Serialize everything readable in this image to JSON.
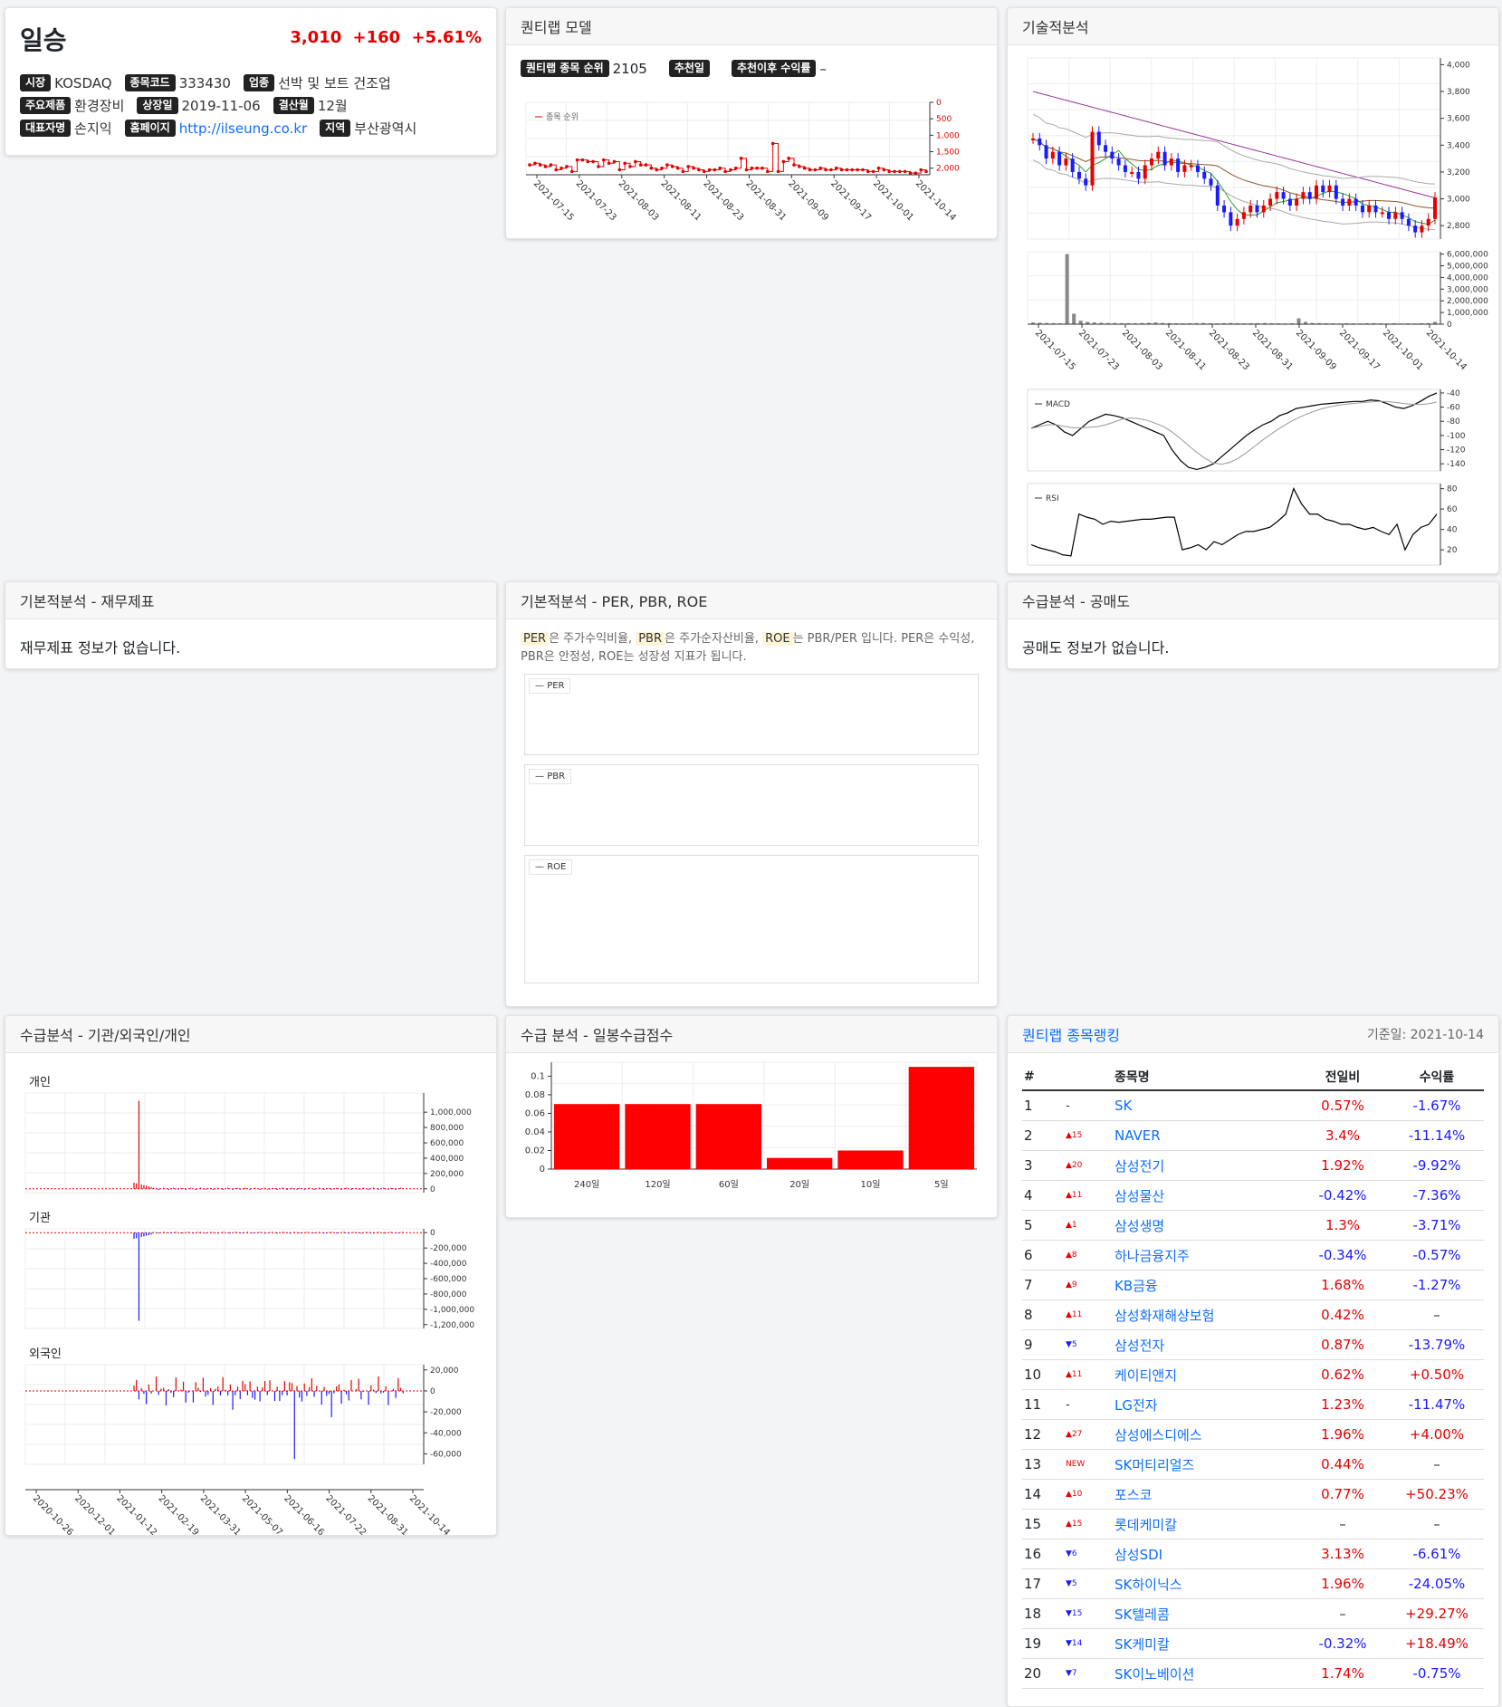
{
  "stock": {
    "name": "일승",
    "price": "3,010",
    "change": "+160",
    "change_pct": "+5.61%",
    "info": [
      [
        {
          "label": "시장",
          "value": "KOSDAQ"
        },
        {
          "label": "종목코드",
          "value": "333430"
        },
        {
          "label": "업종",
          "value": "선박 및 보트 건조업"
        }
      ],
      [
        {
          "label": "주요제품",
          "value": "환경장비"
        },
        {
          "label": "상장일",
          "value": "2019-11-06"
        },
        {
          "label": "결산월",
          "value": "12월"
        }
      ],
      [
        {
          "label": "대표자명",
          "value": "손지익"
        },
        {
          "label": "홈페이지",
          "value": "http://ilseung.co.kr",
          "link": true
        },
        {
          "label": "지역",
          "value": "부산광역시"
        }
      ]
    ]
  },
  "quantilab": {
    "title": "퀀티랩 모델",
    "rank_label": "퀀티랩 종목 순위",
    "rank_value": "2105",
    "recommend_label": "추천일",
    "recommend_value": "",
    "return_label": "추천이후 수익률",
    "return_value": "–"
  },
  "technical": {
    "title": "기술적분석"
  },
  "fundamental": {
    "title": "기본적분석 - 재무제표",
    "empty": "재무제표 정보가 없습니다."
  },
  "ratios": {
    "title": "기본적분석 - PER, PBR, ROE",
    "desc": [
      {
        "t": "PER",
        "hl": true
      },
      {
        "t": "은 주가수익비율, "
      },
      {
        "t": "PBR",
        "hl": true
      },
      {
        "t": "은 주가순자산비율, "
      },
      {
        "t": "ROE",
        "hl": true
      },
      {
        "t": "는 PBR/PER 입니다. PER은 수익성, PBR은 안정성, ROE는 성장성 지표가 됩니다."
      }
    ],
    "legends": [
      "PER",
      "PBR",
      "ROE"
    ]
  },
  "short": {
    "title": "수급분석 - 공매도",
    "empty": "공매도 정보가 없습니다."
  },
  "investor": {
    "title": "수급분석 - 기관/외국인/개인",
    "labels": [
      "개인",
      "기관",
      "외국인"
    ]
  },
  "daily": {
    "title": "수급 분석 - 일봉수급점수"
  },
  "ranking": {
    "title": "퀀티랩 종목랭킹",
    "date": "기준일: 2021-10-14",
    "headers": [
      "#",
      "",
      "종목명",
      "전일비",
      "수익률"
    ],
    "rows": [
      {
        "n": "1",
        "mv": "-",
        "dir": "none",
        "name": "SK",
        "chg": "0.57%",
        "ret": "-1.67%"
      },
      {
        "n": "2",
        "mv": "▲15",
        "dir": "up",
        "name": "NAVER",
        "chg": "3.4%",
        "ret": "-11.14%"
      },
      {
        "n": "3",
        "mv": "▲20",
        "dir": "up",
        "name": "삼성전기",
        "chg": "1.92%",
        "ret": "-9.92%"
      },
      {
        "n": "4",
        "mv": "▲11",
        "dir": "up",
        "name": "삼성물산",
        "chg": "-0.42%",
        "ret": "-7.36%"
      },
      {
        "n": "5",
        "mv": "▲1",
        "dir": "up",
        "name": "삼성생명",
        "chg": "1.3%",
        "ret": "-3.71%"
      },
      {
        "n": "6",
        "mv": "▲8",
        "dir": "up",
        "name": "하나금융지주",
        "chg": "-0.34%",
        "ret": "-0.57%"
      },
      {
        "n": "7",
        "mv": "▲9",
        "dir": "up",
        "name": "KB금융",
        "chg": "1.68%",
        "ret": "-1.27%"
      },
      {
        "n": "8",
        "mv": "▲11",
        "dir": "up",
        "name": "삼성화재해상보험",
        "chg": "0.42%",
        "ret": "–"
      },
      {
        "n": "9",
        "mv": "▼5",
        "dir": "down",
        "name": "삼성전자",
        "chg": "0.87%",
        "ret": "-13.79%"
      },
      {
        "n": "10",
        "mv": "▲11",
        "dir": "up",
        "name": "케이티앤지",
        "chg": "0.62%",
        "ret": "+0.50%"
      },
      {
        "n": "11",
        "mv": "-",
        "dir": "none",
        "name": "LG전자",
        "chg": "1.23%",
        "ret": "-11.47%"
      },
      {
        "n": "12",
        "mv": "▲27",
        "dir": "up",
        "name": "삼성에스디에스",
        "chg": "1.96%",
        "ret": "+4.00%"
      },
      {
        "n": "13",
        "mv": "NEW",
        "dir": "up",
        "name": "SK머티리얼즈",
        "chg": "0.44%",
        "ret": "–"
      },
      {
        "n": "14",
        "mv": "▲10",
        "dir": "up",
        "name": "포스코",
        "chg": "0.77%",
        "ret": "+50.23%"
      },
      {
        "n": "15",
        "mv": "▲15",
        "dir": "up",
        "name": "롯데케미칼",
        "chg": "–",
        "ret": "–"
      },
      {
        "n": "16",
        "mv": "▼6",
        "dir": "down",
        "name": "삼성SDI",
        "chg": "3.13%",
        "ret": "-6.61%"
      },
      {
        "n": "17",
        "mv": "▼5",
        "dir": "down",
        "name": "SK하이닉스",
        "chg": "1.96%",
        "ret": "-24.05%"
      },
      {
        "n": "18",
        "mv": "▼15",
        "dir": "down",
        "name": "SK텔레콤",
        "chg": "–",
        "ret": "+29.27%"
      },
      {
        "n": "19",
        "mv": "▼14",
        "dir": "down",
        "name": "SK케미칼",
        "chg": "-0.32%",
        "ret": "+18.49%"
      },
      {
        "n": "20",
        "mv": "▼7",
        "dir": "down",
        "name": "SK이노베이션",
        "chg": "1.74%",
        "ret": "-0.75%"
      }
    ]
  },
  "chart_data": [
    {
      "type": "line",
      "name": "quantilab-rank",
      "legend": "종목 순위",
      "x_ticks": [
        "2021-07-15",
        "2021-07-23",
        "2021-08-03",
        "2021-08-11",
        "2021-08-23",
        "2021-08-31",
        "2021-09-09",
        "2021-09-17",
        "2021-10-01",
        "2021-10-14"
      ],
      "y_ticks": [
        "0",
        "500",
        "1,000",
        "1,500",
        "2,000"
      ],
      "ylim": [
        0,
        2200
      ],
      "y_inverted": true,
      "values": [
        1900,
        1850,
        1900,
        1950,
        1900,
        2050,
        2000,
        1950,
        2100,
        1750,
        1750,
        1800,
        1800,
        1950,
        1750,
        1850,
        1800,
        2050,
        1850,
        1950,
        1800,
        1900,
        1900,
        2000,
        2050,
        2000,
        1900,
        1950,
        2000,
        2100,
        1950,
        2000,
        2050,
        2100,
        2050,
        2050,
        2000,
        2100,
        2050,
        2000,
        1700,
        2050,
        2000,
        2000,
        2000,
        2100,
        1250,
        2100,
        1800,
        1700,
        1900,
        1950,
        2000,
        2050,
        2050,
        2000,
        2050,
        2050,
        2000,
        2050,
        2050,
        2050,
        2050,
        2050,
        2100,
        2100,
        2000,
        2050,
        2100,
        2100,
        2100,
        2100,
        2150,
        2150,
        2050,
        2100
      ]
    },
    {
      "type": "line",
      "name": "price-candles",
      "y_ticks": [
        "2,800",
        "3,000",
        "3,200",
        "3,400",
        "3,600",
        "3,800",
        "4,000"
      ],
      "ylim": [
        2700,
        4050
      ],
      "close": [
        3450,
        3400,
        3300,
        3350,
        3250,
        3300,
        3200,
        3150,
        3100,
        3500,
        3400,
        3350,
        3300,
        3250,
        3200,
        3200,
        3150,
        3250,
        3300,
        3350,
        3250,
        3300,
        3200,
        3250,
        3250,
        3200,
        3150,
        3100,
        2950,
        2900,
        2800,
        2850,
        2900,
        2950,
        2900,
        2950,
        3000,
        3050,
        3000,
        2950,
        3000,
        3050,
        3000,
        3100,
        3050,
        3100,
        3000,
        2950,
        3000,
        2950,
        2900,
        2950,
        2900,
        2900,
        2850,
        2900,
        2850,
        2800,
        2750,
        2800,
        2850,
        3010
      ]
    },
    {
      "type": "bar",
      "name": "volume",
      "y_ticks": [
        "0",
        "1,000,000",
        "2,000,000",
        "3,000,000",
        "4,000,000",
        "5,000,000",
        "6,000,000"
      ],
      "ylim": [
        0,
        6200000
      ],
      "x_ticks": [
        "2021-07-15",
        "2021-07-23",
        "2021-08-03",
        "2021-08-11",
        "2021-08-23",
        "2021-08-31",
        "2021-09-09",
        "2021-09-17",
        "2021-10-01",
        "2021-10-14"
      ],
      "values": [
        150000,
        120000,
        100000,
        90000,
        80000,
        6000000,
        900000,
        300000,
        200000,
        150000,
        120000,
        100000,
        100000,
        90000,
        90000,
        80000,
        100000,
        120000,
        150000,
        100000,
        90000,
        80000,
        70000,
        80000,
        90000,
        100000,
        80000,
        70000,
        90000,
        100000,
        80000,
        70000,
        80000,
        90000,
        100000,
        80000,
        70000,
        60000,
        80000,
        500000,
        200000,
        100000,
        90000,
        80000,
        70000,
        60000,
        80000,
        70000,
        60000,
        80000,
        90000,
        70000,
        60000,
        80000,
        60000,
        70000,
        60000,
        80000,
        90000,
        200000
      ]
    },
    {
      "type": "line",
      "name": "macd",
      "legend": "MACD",
      "y_ticks": [
        "-40",
        "-60",
        "-80",
        "-100",
        "-120",
        "-140"
      ],
      "ylim": [
        -150,
        -35
      ],
      "values": [
        -90,
        -85,
        -80,
        -85,
        -95,
        -100,
        -90,
        -80,
        -75,
        -70,
        -72,
        -75,
        -80,
        -85,
        -90,
        -95,
        -100,
        -120,
        -135,
        -145,
        -148,
        -145,
        -140,
        -130,
        -120,
        -110,
        -100,
        -92,
        -85,
        -80,
        -72,
        -68,
        -62,
        -60,
        -58,
        -56,
        -55,
        -54,
        -53,
        -52,
        -52,
        -50,
        -51,
        -55,
        -60,
        -62,
        -58,
        -52,
        -45,
        -40
      ]
    },
    {
      "type": "line",
      "name": "rsi",
      "legend": "RSI",
      "y_ticks": [
        "20",
        "40",
        "60",
        "80"
      ],
      "ylim": [
        5,
        85
      ],
      "values": [
        25,
        22,
        20,
        18,
        15,
        14,
        55,
        52,
        50,
        45,
        48,
        47,
        48,
        49,
        50,
        50,
        51,
        52,
        52,
        20,
        22,
        25,
        20,
        28,
        25,
        30,
        35,
        38,
        38,
        40,
        42,
        48,
        55,
        80,
        65,
        55,
        55,
        50,
        48,
        45,
        45,
        42,
        40,
        42,
        38,
        35,
        45,
        20,
        35,
        42,
        45,
        55
      ]
    },
    {
      "type": "bar",
      "name": "investor",
      "x_ticks": [
        "2020-10-26",
        "2020-12-01",
        "2021-01-12",
        "2021-02-19",
        "2021-03-31",
        "2021-05-07",
        "2021-06-16",
        "2021-07-22",
        "2021-08-31",
        "2021-10-14"
      ],
      "series": [
        {
          "name": "개인",
          "y_ticks": [
            "0",
            "200,000",
            "400,000",
            "600,000",
            "800,000",
            "1,000,000"
          ],
          "ylim": [
            -50000,
            1250000
          ]
        },
        {
          "name": "기관",
          "y_ticks": [
            "0",
            "-200,000",
            "-400,000",
            "-600,000",
            "-800,000",
            "-1,000,000",
            "-1,200,000"
          ],
          "ylim": [
            -1250000,
            50000
          ]
        },
        {
          "name": "외국인",
          "y_ticks": [
            "20,000",
            "0",
            "-20,000",
            "-40,000",
            "-60,000"
          ],
          "ylim": [
            -70000,
            25000
          ]
        }
      ]
    },
    {
      "type": "bar",
      "name": "daily-score",
      "categories": [
        "240일",
        "120일",
        "60일",
        "20일",
        "10일",
        "5일"
      ],
      "values": [
        0.07,
        0.07,
        0.07,
        0.012,
        0.02,
        0.11
      ],
      "y_ticks": [
        "0",
        "0.02",
        "0.04",
        "0.06",
        "0.08",
        "0.1"
      ],
      "ylim": [
        0,
        0.115
      ]
    }
  ]
}
